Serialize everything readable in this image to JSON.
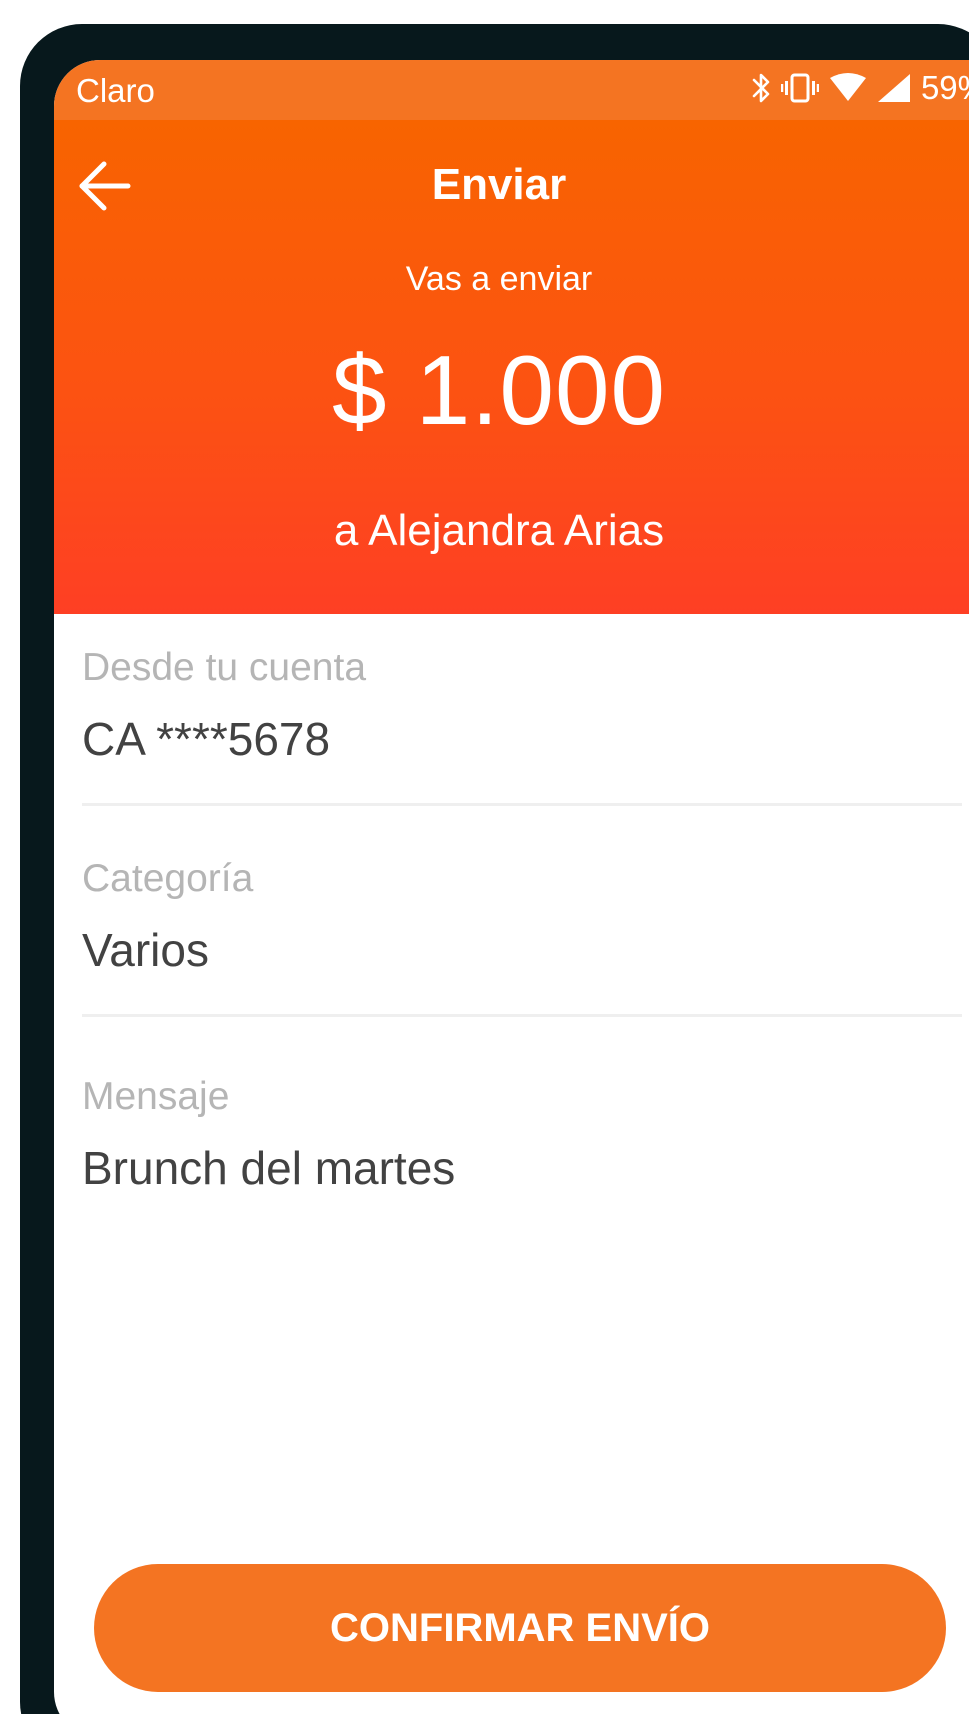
{
  "status_bar": {
    "carrier": "Claro",
    "battery": "59%",
    "icons": [
      "bluetooth-icon",
      "vibrate-icon",
      "wifi-icon",
      "cell-signal-icon"
    ]
  },
  "header": {
    "back_icon": "arrow-left-icon",
    "title": "Enviar",
    "subtitle": "Vas a enviar",
    "amount": "$ 1.000",
    "recipient": "a Alejandra Arias"
  },
  "details": {
    "account": {
      "label": "Desde tu cuenta",
      "value": "CA ****5678"
    },
    "category": {
      "label": "Categoría",
      "value": "Varios"
    },
    "message": {
      "label": "Mensaje",
      "value": "Brunch del martes"
    }
  },
  "actions": {
    "confirm_label": "CONFIRMAR ENVÍO"
  },
  "colors": {
    "accent": "#f47422",
    "header_top": "#f86400",
    "header_bottom": "#fe3f24",
    "label_text": "#b5b5b5",
    "value_text": "#424242"
  }
}
